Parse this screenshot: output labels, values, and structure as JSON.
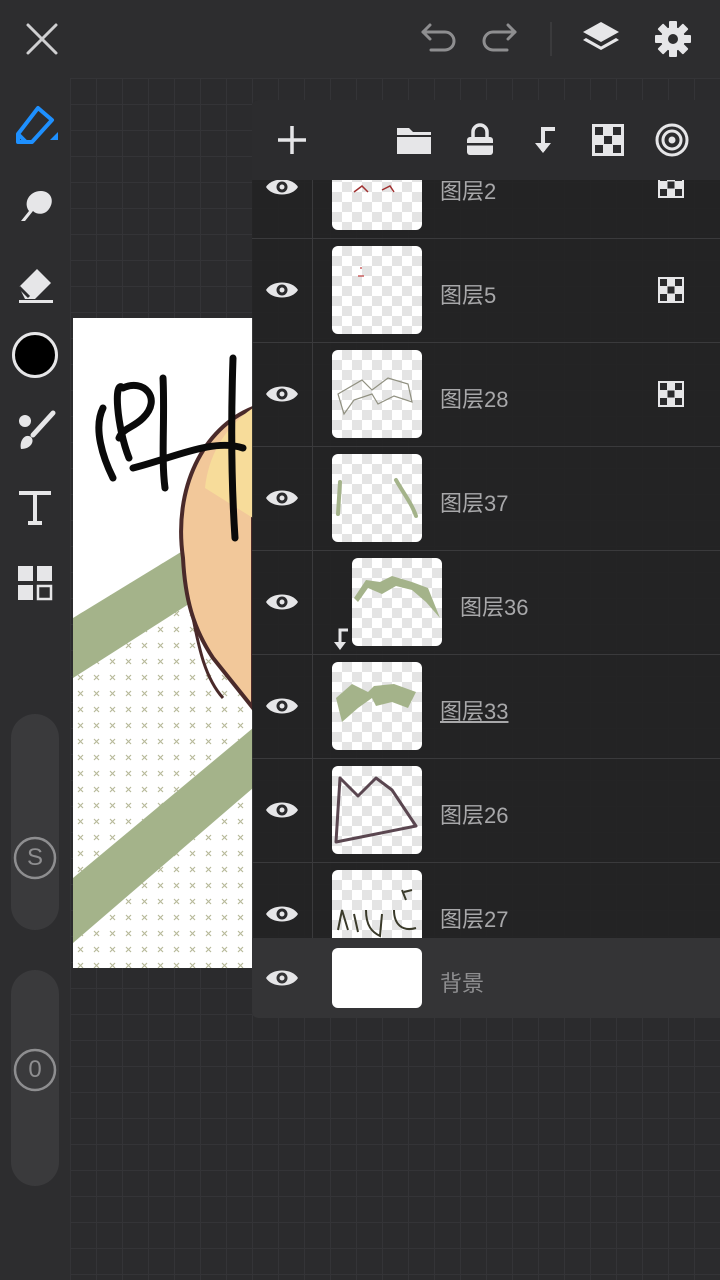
{
  "app": {
    "topbar": {
      "close_icon": "close-icon",
      "undo_icon": "undo-icon",
      "redo_icon": "redo-icon",
      "layers_icon": "layers-icon",
      "settings_icon": "gear-icon"
    },
    "tools": [
      "pen-icon",
      "smudge-icon",
      "eraser-icon",
      "color-swatch",
      "brush-icon",
      "text-icon",
      "grid-icon"
    ],
    "sliders": {
      "size_label": "S",
      "opacity_label": "0"
    },
    "colors": {
      "accent": "#1e90ff",
      "primary_color": "#000000",
      "panel_bg": "#222224",
      "text_muted": "#a8a8aa"
    }
  },
  "layers_panel": {
    "toolbar": [
      "add-layer-icon",
      "folder-icon",
      "lock-icon",
      "clip-down-icon",
      "alpha-lock-icon",
      "blend-icon"
    ],
    "layers": [
      {
        "name": "图层2",
        "alpha_lock": true,
        "clipped": false,
        "selected": false
      },
      {
        "name": "图层5",
        "alpha_lock": true,
        "clipped": false,
        "selected": false
      },
      {
        "name": "图层28",
        "alpha_lock": true,
        "clipped": false,
        "selected": false
      },
      {
        "name": "图层37",
        "alpha_lock": false,
        "clipped": false,
        "selected": false
      },
      {
        "name": "图层36",
        "alpha_lock": false,
        "clipped": true,
        "selected": false
      },
      {
        "name": "图层33",
        "alpha_lock": false,
        "clipped": false,
        "selected": true
      },
      {
        "name": "图层26",
        "alpha_lock": false,
        "clipped": false,
        "selected": false
      },
      {
        "name": "图层27",
        "alpha_lock": false,
        "clipped": false,
        "selected": false
      }
    ],
    "background": {
      "name": "背景"
    }
  }
}
